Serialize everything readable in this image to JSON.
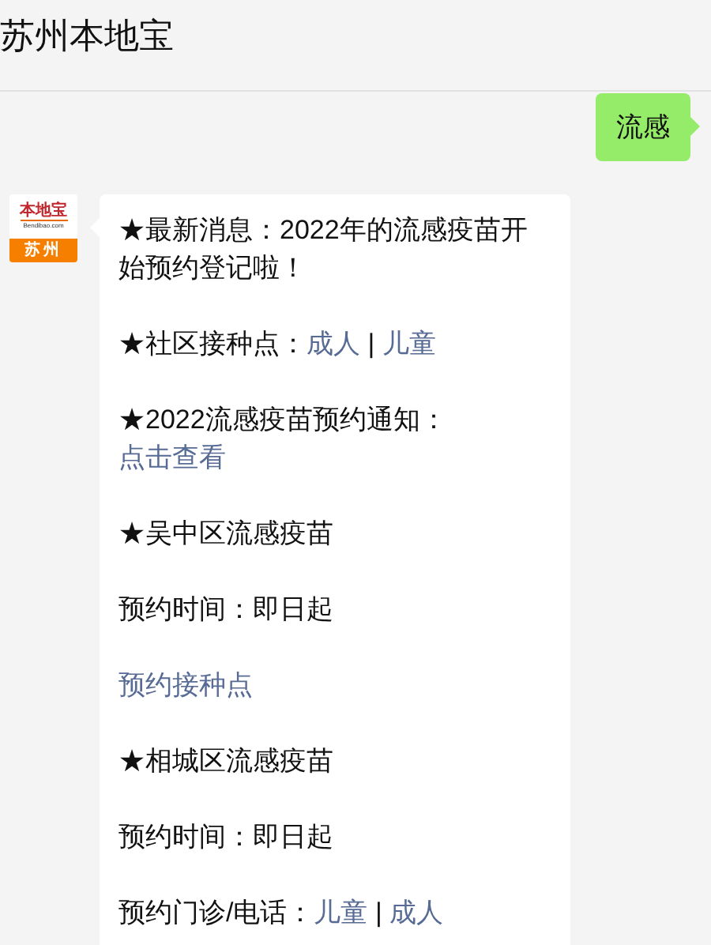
{
  "header": {
    "title": "苏州本地宝"
  },
  "sent_message": {
    "text": "流感"
  },
  "avatar": {
    "brand": "本地宝",
    "domain": "Bendibao.com",
    "city": "苏州"
  },
  "reply_paragraphs": [
    [
      {
        "text": "★最新消息：2022年的流感疫苗开始预约登记啦！",
        "link": false
      }
    ],
    [
      {
        "text": "★社区接种点：",
        "link": false
      },
      {
        "text": "成人",
        "link": true
      },
      {
        "text": " | ",
        "link": false
      },
      {
        "text": "儿童",
        "link": true
      }
    ],
    [
      {
        "text": "★2022流感疫苗预约通知：",
        "link": false
      },
      {
        "text": "点击查看",
        "link": true
      }
    ],
    [
      {
        "text": "★吴中区流感疫苗",
        "link": false
      }
    ],
    [
      {
        "text": "预约时间：即日起",
        "link": false
      }
    ],
    [
      {
        "text": "预约接种点",
        "link": true
      }
    ],
    [
      {
        "text": "★相城区流感疫苗",
        "link": false
      }
    ],
    [
      {
        "text": "预约时间：即日起",
        "link": false
      }
    ],
    [
      {
        "text": "预约门诊/电话：",
        "link": false
      },
      {
        "text": "儿童",
        "link": true
      },
      {
        "text": " | ",
        "link": false
      },
      {
        "text": "成人",
        "link": true
      }
    ]
  ]
}
